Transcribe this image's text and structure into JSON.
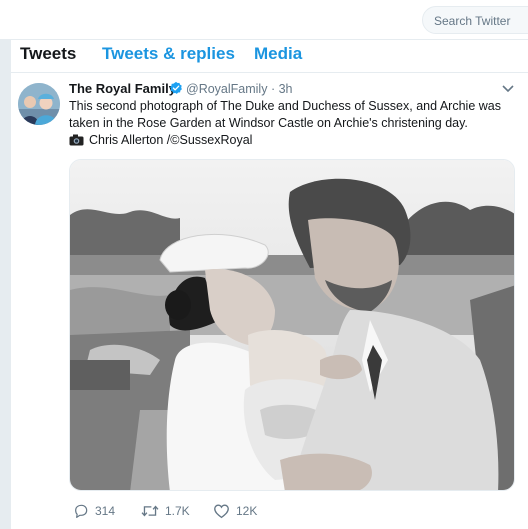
{
  "search": {
    "placeholder": "Search Twitter"
  },
  "tabs": [
    {
      "label": "Tweets",
      "active": true
    },
    {
      "label": "Tweets & replies",
      "active": false
    },
    {
      "label": "Media",
      "active": false
    }
  ],
  "tweet": {
    "author_name": "The Royal Family",
    "handle": "@RoyalFamily",
    "separator": "·",
    "time": "3h",
    "text": "This second photograph of The Duke and Duchess of Sussex, and Archie was taken in the Rose Garden at Windsor Castle on Archie's christening day.",
    "credit": "Chris Allerton /©SussexRoyal",
    "image_alt": "Black and white photograph of the couple with their baby in a rose garden",
    "reply_count": "314",
    "retweet_count": "1.7K",
    "like_count": "12K"
  },
  "icons": {
    "search": "search-icon",
    "verified": "verified-badge-icon",
    "caret": "chevron-down-icon",
    "camera": "camera-icon",
    "reply": "reply-icon",
    "retweet": "retweet-icon",
    "like": "heart-icon"
  },
  "colors": {
    "accent": "#1b95e0",
    "text": "#14171a",
    "secondary": "#657786",
    "background": "#e6ecf0"
  }
}
